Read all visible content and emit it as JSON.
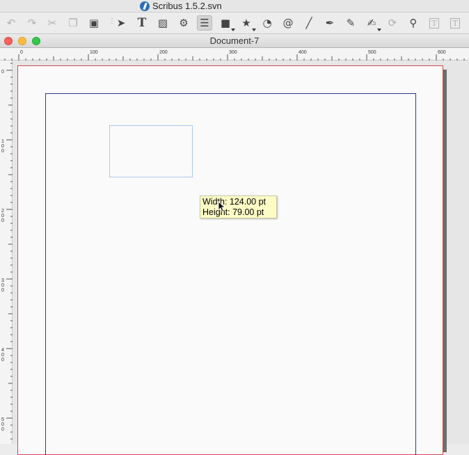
{
  "app": {
    "title": "Scribus 1.5.2.svn"
  },
  "toolbar": {
    "items": [
      {
        "name": "undo-icon",
        "glyph": "↶",
        "enabled": false
      },
      {
        "name": "redo-icon",
        "glyph": "↷",
        "enabled": false
      },
      {
        "name": "cut-icon",
        "glyph": "✂",
        "enabled": false
      },
      {
        "name": "copy-icon",
        "glyph": "❐",
        "enabled": false
      },
      {
        "name": "paste-icon",
        "glyph": "▣",
        "enabled": true
      },
      {
        "name": "select-icon",
        "glyph": "➤",
        "enabled": true
      },
      {
        "name": "text-frame-icon",
        "glyph": "T",
        "enabled": true
      },
      {
        "name": "image-frame-icon",
        "glyph": "▨",
        "enabled": true
      },
      {
        "name": "render-frame-icon",
        "glyph": "⚙",
        "enabled": true
      },
      {
        "name": "table-icon",
        "glyph": "☰",
        "enabled": true,
        "active": true
      },
      {
        "name": "shape-icon",
        "glyph": "■",
        "enabled": true
      },
      {
        "name": "polygon-icon",
        "glyph": "★",
        "enabled": true
      },
      {
        "name": "arc-icon",
        "glyph": "◔",
        "enabled": true
      },
      {
        "name": "spiral-icon",
        "glyph": "@",
        "enabled": true
      },
      {
        "name": "line-icon",
        "glyph": "╱",
        "enabled": true
      },
      {
        "name": "bezier-icon",
        "glyph": "✒",
        "enabled": true
      },
      {
        "name": "freehand-icon",
        "glyph": "✎",
        "enabled": true
      },
      {
        "name": "calligraphic-icon",
        "glyph": "✍",
        "enabled": true
      },
      {
        "name": "rotate-icon",
        "glyph": "⟳",
        "enabled": false
      },
      {
        "name": "zoom-icon",
        "glyph": "⚲",
        "enabled": true
      },
      {
        "name": "edit-text-icon",
        "glyph": "T",
        "enabled": false
      },
      {
        "name": "link-text-icon",
        "glyph": "T",
        "enabled": false
      }
    ]
  },
  "document": {
    "title": "Document-7"
  },
  "ruler": {
    "horizontal_labels": [
      "0",
      "100",
      "200",
      "300",
      "400",
      "500",
      "600"
    ],
    "vertical_labels": [
      "0",
      "100",
      "200",
      "300",
      "400",
      "500"
    ]
  },
  "tooltip": {
    "width_line": "Width: 124.00 pt",
    "height_line": "Height: 79.00 pt"
  }
}
